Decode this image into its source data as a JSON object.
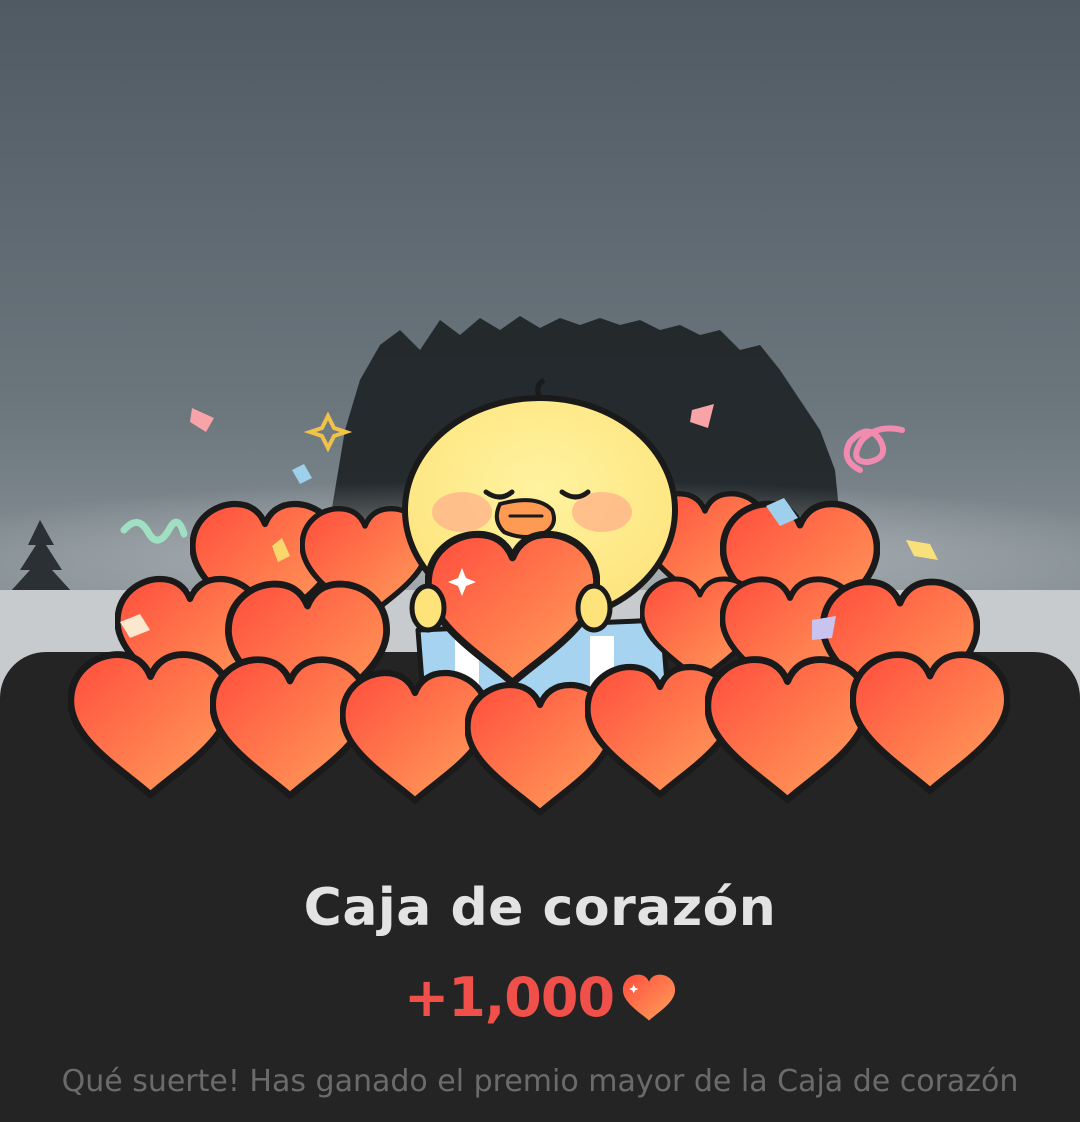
{
  "reward_popup": {
    "title": "Caja de corazón",
    "amount": "+1,000",
    "amount_icon": "heart-icon",
    "description": "Qué suerte! Has ganado el premio mayor de la Caja de corazón",
    "accent_color": "#f0504a"
  },
  "illustration": {
    "character": "yellow-chick",
    "background": "foggy-winter-forest",
    "colors": {
      "heart_light": "#ff9f5a",
      "heart_dark": "#ff3f3f",
      "outline": "#1a1a1a"
    }
  }
}
